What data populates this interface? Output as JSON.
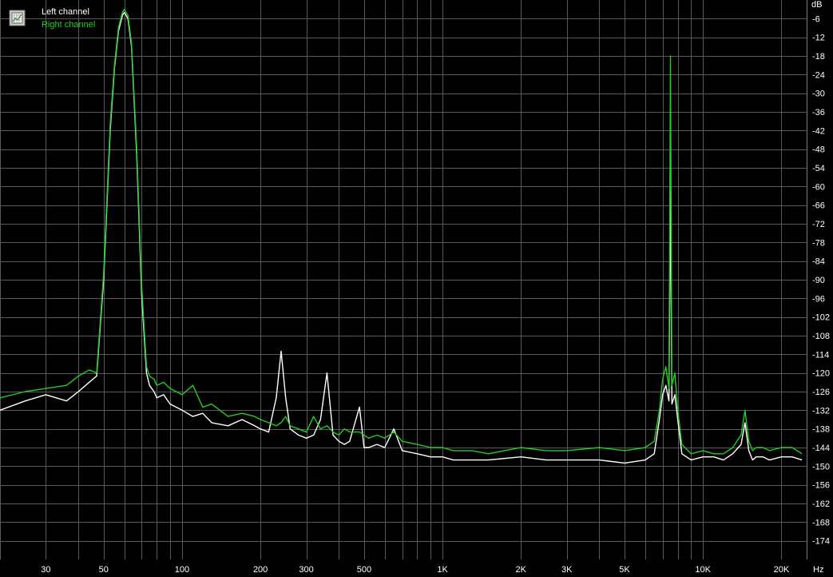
{
  "chart_data": {
    "type": "line",
    "xscale": "log",
    "xlabel": "Hz",
    "ylabel": "dB",
    "xlim": [
      20,
      25000
    ],
    "ylim": [
      -180,
      0
    ],
    "grid": true,
    "legend_position": "top-left",
    "background_color": "#000000",
    "grid_color": "#5a5a5a",
    "x_ticks": [
      {
        "value": 30,
        "label": "30"
      },
      {
        "value": 50,
        "label": "50"
      },
      {
        "value": 100,
        "label": "100"
      },
      {
        "value": 200,
        "label": "200"
      },
      {
        "value": 300,
        "label": "300"
      },
      {
        "value": 500,
        "label": "500"
      },
      {
        "value": 1000,
        "label": "1K"
      },
      {
        "value": 2000,
        "label": "2K"
      },
      {
        "value": 3000,
        "label": "3K"
      },
      {
        "value": 5000,
        "label": "5K"
      },
      {
        "value": 10000,
        "label": "10K"
      },
      {
        "value": 20000,
        "label": "20K"
      }
    ],
    "y_ticks": [
      -6,
      -12,
      -18,
      -24,
      -30,
      -36,
      -42,
      -48,
      -54,
      -60,
      -66,
      -72,
      -78,
      -84,
      -90,
      -96,
      -102,
      -108,
      -114,
      -120,
      -126,
      -132,
      -138,
      -144,
      -150,
      -156,
      -162,
      -168,
      -174
    ],
    "series": [
      {
        "name": "Left channel",
        "color": "#ffffff",
        "x": [
          20,
          25,
          30,
          36,
          40,
          44,
          47,
          50,
          53,
          55,
          57,
          59,
          60,
          62,
          64,
          67,
          70,
          73,
          75,
          78,
          80,
          85,
          90,
          100,
          110,
          120,
          130,
          150,
          170,
          190,
          200,
          215,
          230,
          240,
          250,
          260,
          280,
          300,
          320,
          340,
          360,
          380,
          400,
          420,
          440,
          480,
          500,
          520,
          560,
          600,
          650,
          700,
          800,
          900,
          1000,
          1100,
          1300,
          1500,
          2000,
          2500,
          3000,
          4000,
          5000,
          6000,
          6500,
          6800,
          7000,
          7200,
          7400,
          7500,
          7600,
          7800,
          8000,
          8300,
          9000,
          10000,
          11000,
          12000,
          13000,
          14000,
          14500,
          15000,
          15500,
          16000,
          17000,
          18000,
          20000,
          22000,
          24000
        ],
        "y": [
          -132,
          -129,
          -127,
          -129,
          -126,
          -123,
          -121,
          -90,
          -42,
          -22,
          -10,
          -5,
          -4,
          -6,
          -15,
          -50,
          -95,
          -120,
          -124,
          -126,
          -128,
          -127,
          -130,
          -132,
          -134,
          -133,
          -136,
          -137,
          -135,
          -137,
          -138,
          -139,
          -128,
          -113,
          -128,
          -138,
          -140,
          -141,
          -140,
          -135,
          -120,
          -140,
          -142,
          -143,
          -142,
          -131,
          -144,
          -144,
          -143,
          -144,
          -138,
          -145,
          -146,
          -147,
          -147,
          -148,
          -148,
          -148,
          -147,
          -148,
          -148,
          -148,
          -149,
          -148,
          -146,
          -135,
          -127,
          -124,
          -129,
          -60,
          -130,
          -127,
          -135,
          -146,
          -148,
          -147,
          -147,
          -148,
          -146,
          -143,
          -136,
          -145,
          -148,
          -147,
          -147,
          -148,
          -147,
          -147,
          -148
        ]
      },
      {
        "name": "Right channel",
        "color": "#22cc22",
        "x": [
          20,
          25,
          30,
          36,
          40,
          44,
          47,
          50,
          53,
          55,
          57,
          59,
          60,
          62,
          64,
          67,
          70,
          73,
          75,
          78,
          80,
          85,
          90,
          100,
          110,
          120,
          130,
          150,
          170,
          190,
          200,
          215,
          230,
          240,
          250,
          260,
          280,
          300,
          320,
          340,
          360,
          380,
          400,
          420,
          440,
          480,
          500,
          520,
          560,
          600,
          650,
          700,
          800,
          900,
          1000,
          1100,
          1300,
          1500,
          2000,
          2500,
          3000,
          4000,
          5000,
          6000,
          6500,
          6800,
          7000,
          7200,
          7400,
          7500,
          7600,
          7800,
          8000,
          8300,
          9000,
          10000,
          11000,
          12000,
          13000,
          14000,
          14500,
          15000,
          15500,
          16000,
          17000,
          18000,
          20000,
          22000,
          24000
        ],
        "y": [
          -128,
          -126,
          -125,
          -124,
          -121,
          -119,
          -120,
          -88,
          -40,
          -21,
          -9,
          -4,
          -3,
          -5,
          -14,
          -48,
          -92,
          -118,
          -121,
          -122,
          -124,
          -123,
          -125,
          -127,
          -124,
          -131,
          -130,
          -134,
          -133,
          -134,
          -135,
          -136,
          -137,
          -136,
          -134,
          -137,
          -138,
          -139,
          -134,
          -138,
          -137,
          -139,
          -140,
          -138,
          -139,
          -139,
          -140,
          -141,
          -140,
          -141,
          -139,
          -142,
          -143,
          -144,
          -144,
          -145,
          -145,
          -146,
          -144,
          -145,
          -145,
          -144,
          -145,
          -144,
          -142,
          -132,
          -122,
          -118,
          -125,
          -18,
          -124,
          -120,
          -132,
          -143,
          -146,
          -145,
          -146,
          -146,
          -144,
          -140,
          -132,
          -142,
          -145,
          -144,
          -144,
          -145,
          -144,
          -144,
          -146
        ]
      }
    ]
  }
}
